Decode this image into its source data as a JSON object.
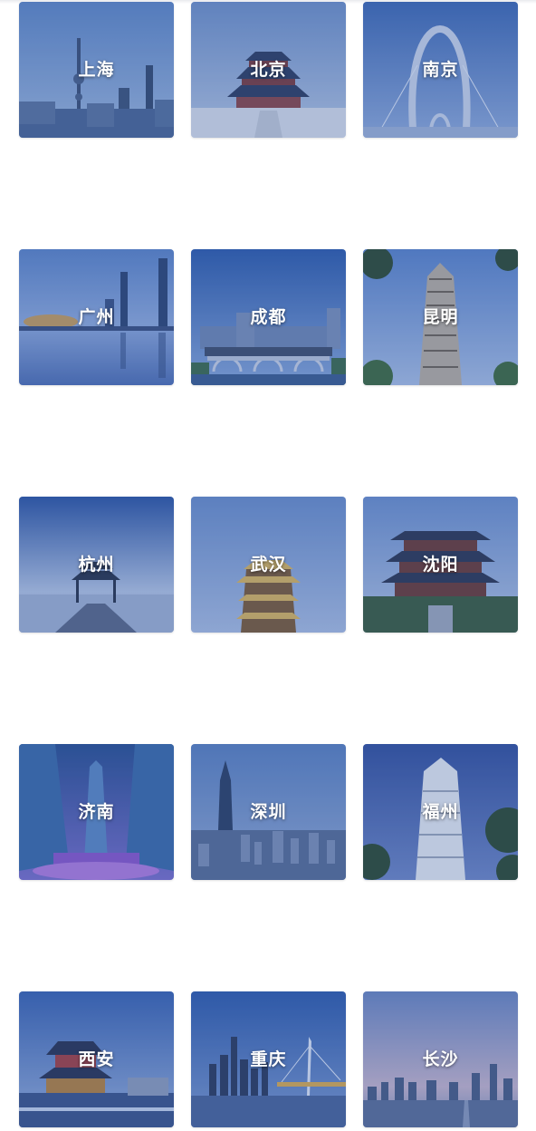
{
  "cities": [
    {
      "name": "上海"
    },
    {
      "name": "北京"
    },
    {
      "name": "南京"
    },
    {
      "name": "广州"
    },
    {
      "name": "成都"
    },
    {
      "name": "昆明"
    },
    {
      "name": "杭州"
    },
    {
      "name": "武汉"
    },
    {
      "name": "沈阳"
    },
    {
      "name": "济南"
    },
    {
      "name": "深圳"
    },
    {
      "name": "福州"
    },
    {
      "name": "西安"
    },
    {
      "name": "重庆"
    },
    {
      "name": "长沙"
    }
  ]
}
